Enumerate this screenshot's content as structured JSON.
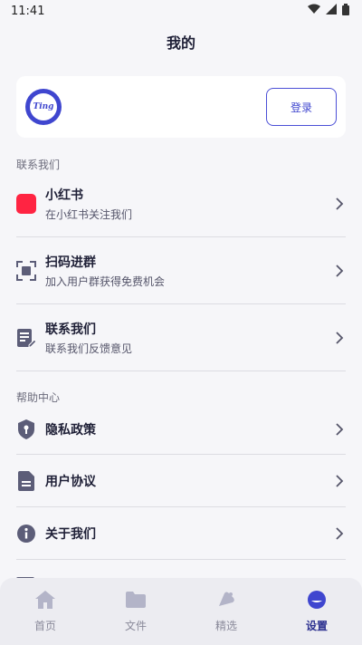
{
  "status_bar": {
    "time": "11:41"
  },
  "header": {
    "title": "我的"
  },
  "profile": {
    "avatar_text": "Ting",
    "login_label": "登录"
  },
  "sections": {
    "contact_title": "联系我们",
    "help_title": "帮助中心"
  },
  "contact_items": [
    {
      "title": "小红书",
      "subtitle": "在小红书关注我们",
      "icon": "xiaohongshu-icon",
      "icon_text": "小红书"
    },
    {
      "title": "扫码进群",
      "subtitle": "加入用户群获得免费机会",
      "icon": "scan-icon"
    },
    {
      "title": "联系我们",
      "subtitle": "联系我们反馈意见",
      "icon": "feedback-icon"
    }
  ],
  "help_items": [
    {
      "title": "隐私政策",
      "icon": "shield-icon"
    },
    {
      "title": "用户协议",
      "icon": "document-icon"
    },
    {
      "title": "关于我们",
      "icon": "info-icon"
    }
  ],
  "bottom_nav": {
    "items": [
      {
        "label": "首页",
        "icon": "home-icon",
        "active": false
      },
      {
        "label": "文件",
        "icon": "folder-icon",
        "active": false
      },
      {
        "label": "精选",
        "icon": "featured-icon",
        "active": false
      },
      {
        "label": "设置",
        "icon": "settings-icon",
        "active": true
      }
    ]
  },
  "colors": {
    "accent": "#3f46cf",
    "background": "#f6f6f9",
    "nav_background": "#ececf1",
    "xiaohongshu": "#ff2442",
    "icon_gray": "#5c5d78"
  }
}
